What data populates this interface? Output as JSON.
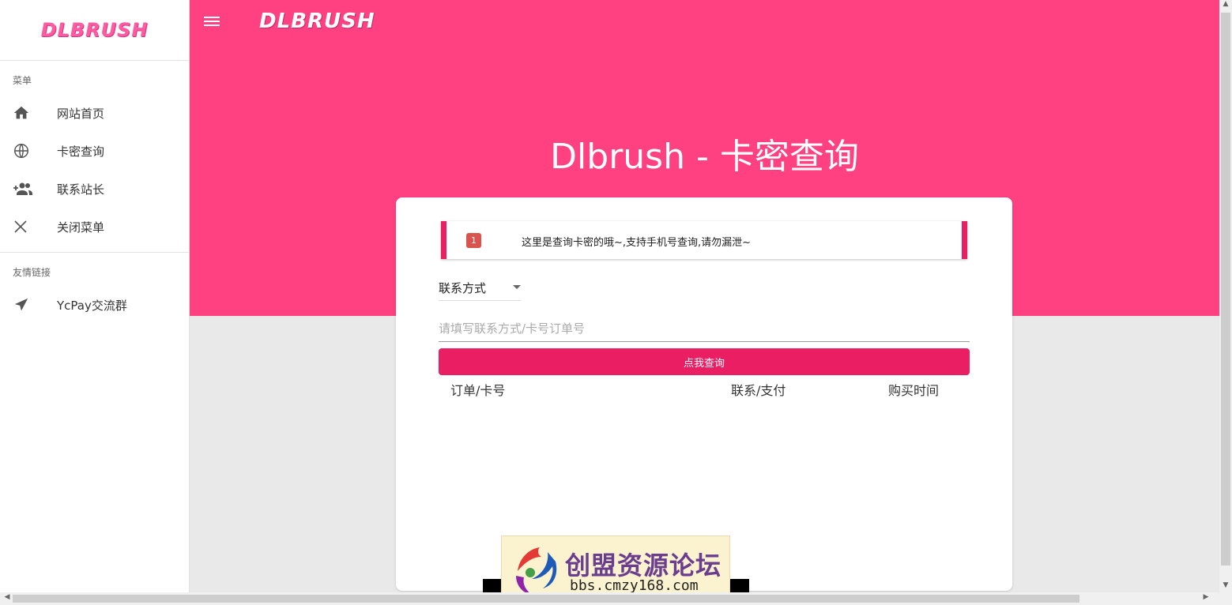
{
  "brand": "DLBRUSH",
  "sidebar": {
    "menu_title": "菜单",
    "items": [
      {
        "label": "网站首页",
        "icon": "home-icon"
      },
      {
        "label": "卡密查询",
        "icon": "globe-icon"
      },
      {
        "label": "联系站长",
        "icon": "group-add-icon"
      },
      {
        "label": "关闭菜单",
        "icon": "close-icon"
      }
    ],
    "links_title": "友情链接",
    "links": [
      {
        "label": "YcPay交流群",
        "icon": "send-icon"
      }
    ]
  },
  "header": {
    "title": "Dlbrush - 卡密查询"
  },
  "notice": {
    "badge": "1",
    "text": "这里是查询卡密的哦~,支持手机号查询,请勿漏泄~"
  },
  "form": {
    "select_value": "联系方式",
    "input_placeholder": "请填写联系方式/卡号订单号",
    "input_value": "",
    "submit_label": "点我查询"
  },
  "table": {
    "columns": [
      "订单/卡号",
      "联系/支付",
      "购买时间"
    ]
  },
  "watermark": {
    "title": "创盟资源论坛",
    "url": "bbs.cmzy168.com"
  },
  "colors": {
    "primary": "#ff4081",
    "button": "#e91e63",
    "badge": "#d9534f"
  }
}
